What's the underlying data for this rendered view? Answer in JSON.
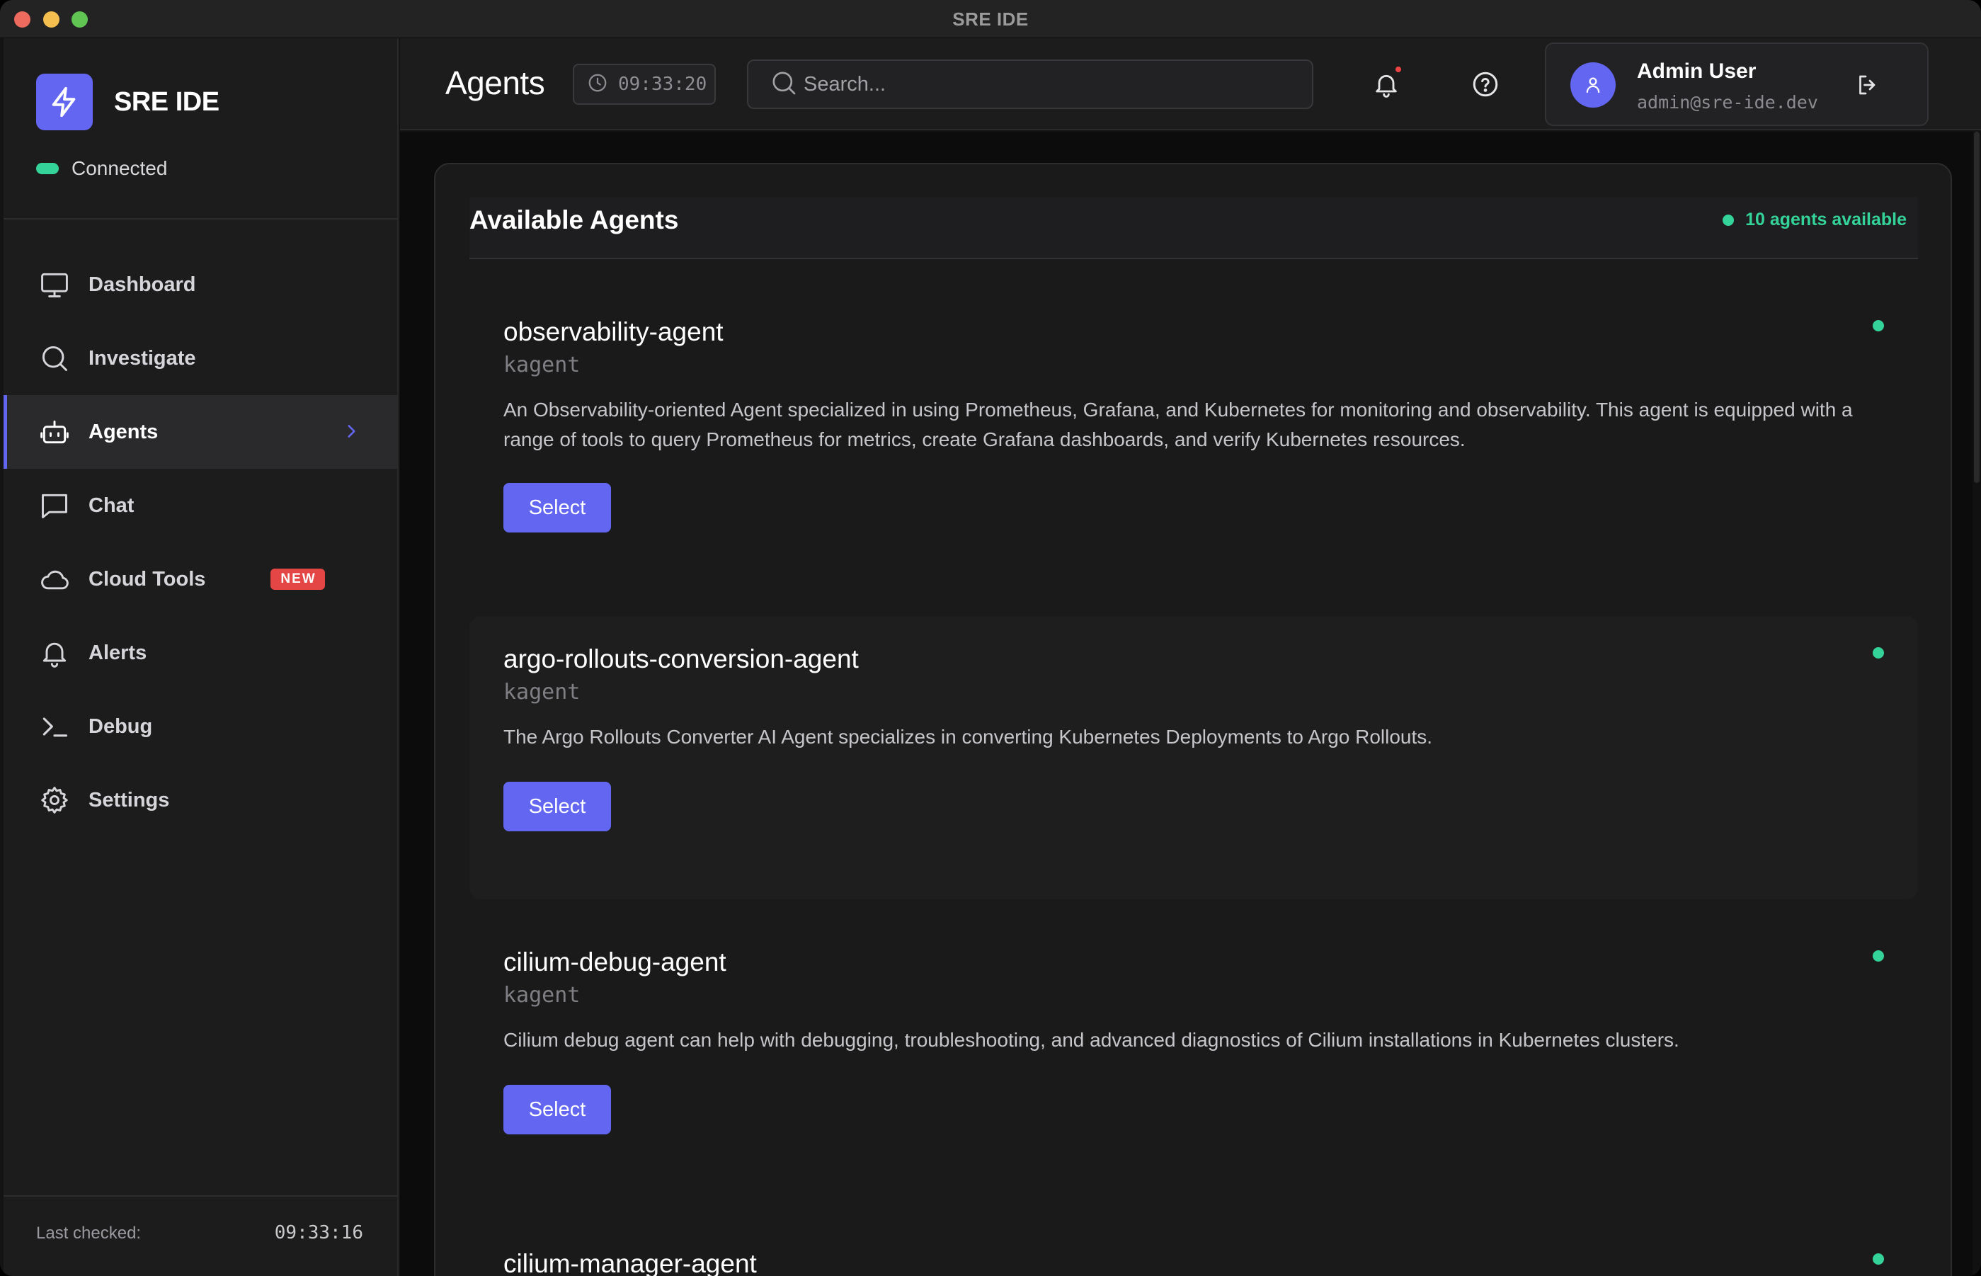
{
  "window": {
    "title": "SRE IDE"
  },
  "sidebar": {
    "brand_name": "SRE IDE",
    "connection_status": "Connected",
    "items": [
      {
        "label": "Dashboard",
        "icon": "monitor-icon"
      },
      {
        "label": "Investigate",
        "icon": "search-icon"
      },
      {
        "label": "Agents",
        "icon": "bot-icon",
        "active": true
      },
      {
        "label": "Chat",
        "icon": "chat-icon"
      },
      {
        "label": "Cloud Tools",
        "icon": "cloud-icon",
        "badge": "NEW"
      },
      {
        "label": "Alerts",
        "icon": "bell-icon"
      },
      {
        "label": "Debug",
        "icon": "terminal-icon"
      },
      {
        "label": "Settings",
        "icon": "gear-icon"
      }
    ],
    "footer": {
      "last_checked_label": "Last checked:",
      "last_checked_time": "09:33:16"
    }
  },
  "header": {
    "title": "Agents",
    "clock": "09:33:20",
    "search_placeholder": "Search...",
    "user": {
      "name": "Admin User",
      "email": "admin@sre-ide.dev"
    }
  },
  "main": {
    "panel_title": "Available Agents",
    "available_count_text": "10 agents available",
    "status_color": "#34d399",
    "accent_color": "#6366f1",
    "agents": [
      {
        "name": "observability-agent",
        "type": "kagent",
        "description": "An Observability-oriented Agent specialized in using Prometheus, Grafana, and Kubernetes for monitoring and observability. This agent is equipped with a range of tools to query Prometheus for metrics, create Grafana dashboards, and verify Kubernetes resources.",
        "button": "Select"
      },
      {
        "name": "argo-rollouts-conversion-agent",
        "type": "kagent",
        "description": "The Argo Rollouts Converter AI Agent specializes in converting Kubernetes Deployments to Argo Rollouts.",
        "button": "Select"
      },
      {
        "name": "cilium-debug-agent",
        "type": "kagent",
        "description": "Cilium debug agent can help with debugging, troubleshooting, and advanced diagnostics of Cilium installations in Kubernetes clusters.",
        "button": "Select"
      },
      {
        "name": "cilium-manager-agent",
        "type": "",
        "description": "",
        "button": ""
      }
    ]
  }
}
